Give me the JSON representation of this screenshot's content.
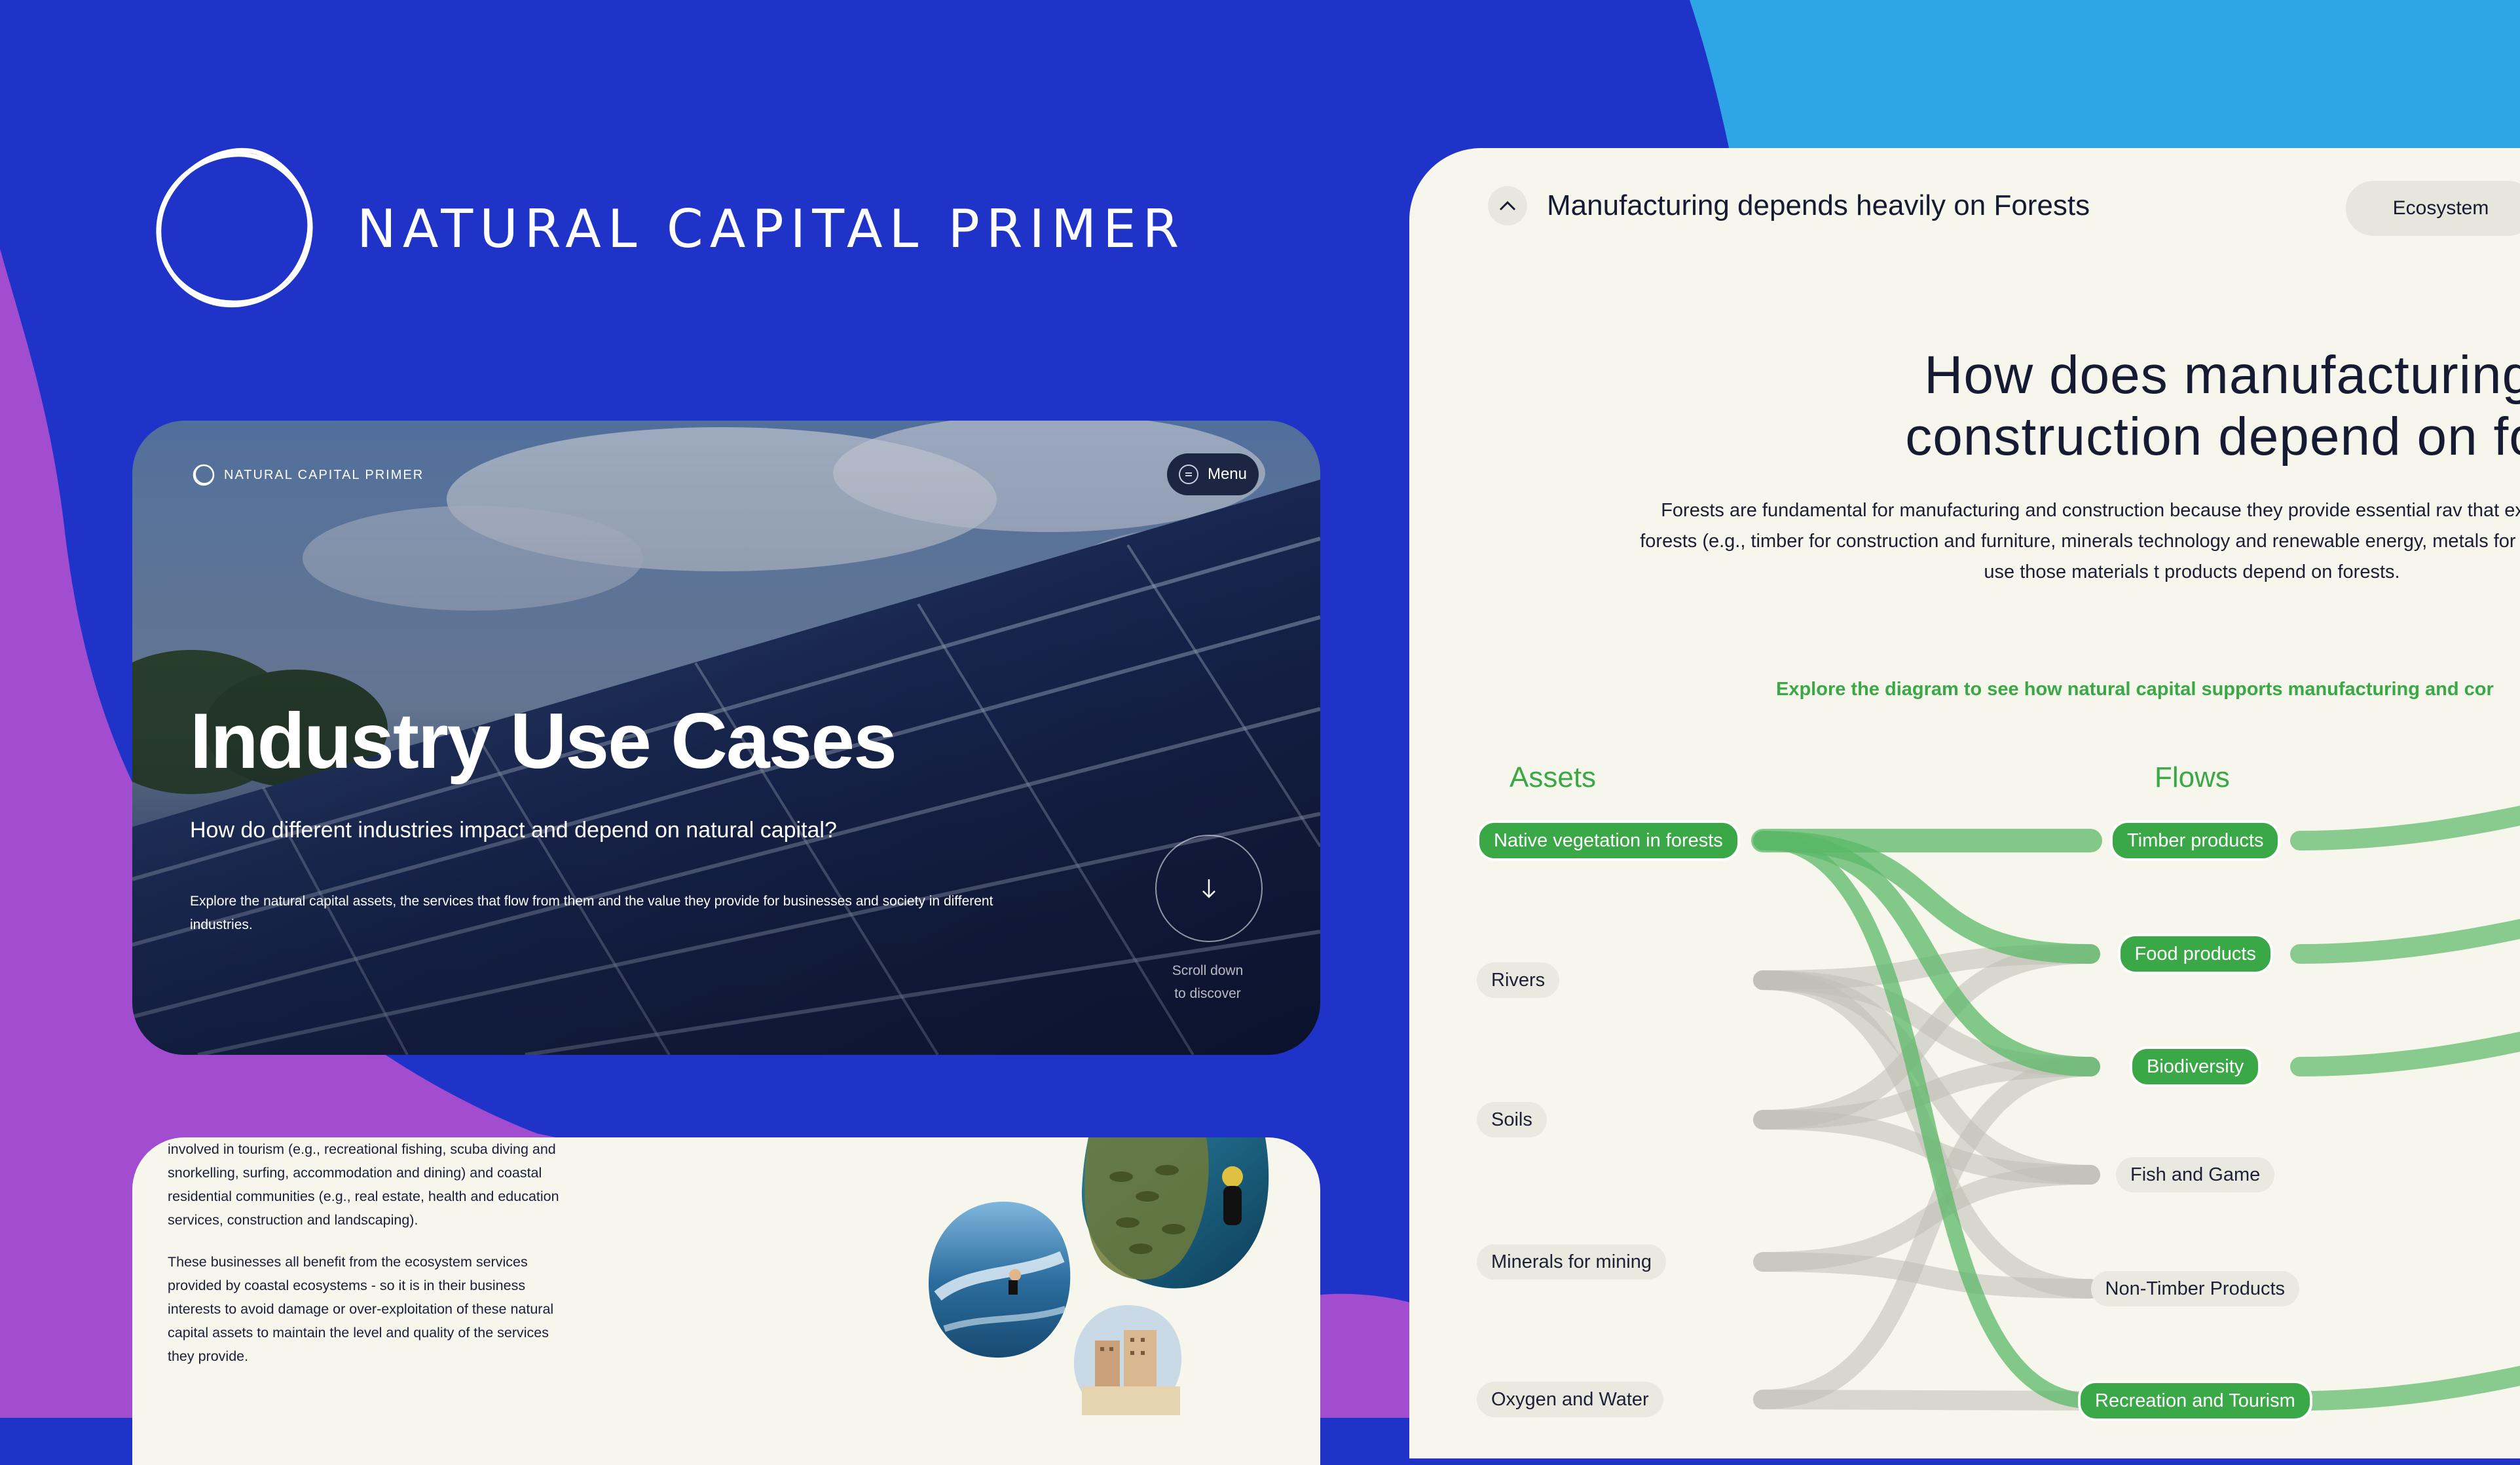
{
  "brand": {
    "title": "NATURAL CAPITAL PRIMER"
  },
  "colors": {
    "background": "#2033c9",
    "accent_purple": "#a24dd0",
    "accent_cyan": "#2ea6e6",
    "green": "#3aa847",
    "panel": "#f6f6ec"
  },
  "hero": {
    "logo_text": "NATURAL CAPITAL PRIMER",
    "menu_label": "Menu",
    "title": "Industry Use Cases",
    "subtitle": "How do different industries impact and depend on natural capital?",
    "body": "Explore the natural capital assets, the services that flow from them and the value they provide for businesses and society in different industries.",
    "scroll_line1": "Scroll down",
    "scroll_line2": "to discover",
    "scroll_icon": "arrow-down-icon"
  },
  "story": {
    "paragraph1": "involved in tourism (e.g., recreational fishing, scuba diving and snorkelling, surfing, accommodation and dining) and coastal residential communities (e.g., real estate, health and education services, construction and landscaping).",
    "paragraph2": "These businesses all benefit from the ecosystem services provided by coastal ecosystems - so it is in their business interests to avoid damage or over-exploitation of these natural capital assets to maintain the level and quality of the services they provide."
  },
  "panel": {
    "heading": "Manufacturing depends heavily on Forests",
    "tab": "Ecosystem",
    "question_line1": "How does manufacturing ar",
    "question_line2": "construction depend on fores",
    "desc": "Forests are fundamental for manufacturing and construction because they provide essential rav that extract raw materials from forests (e.g., timber for construction and furniture, minerals technology and renewable energy, metals for construction and wiring) or use those materials t products depend on forests.",
    "explore": "Explore the diagram to see how natural capital supports manufacturing and cor",
    "col_assets": "Assets",
    "col_flows": "Flows",
    "assets": [
      {
        "label": "Native vegetation in forests",
        "active": true
      },
      {
        "label": "Rivers",
        "active": false
      },
      {
        "label": "Soils",
        "active": false
      },
      {
        "label": "Minerals for mining",
        "active": false
      },
      {
        "label": "Oxygen and Water",
        "active": false
      }
    ],
    "flows": [
      {
        "label": "Timber products",
        "active": true
      },
      {
        "label": "Food products",
        "active": true
      },
      {
        "label": "Biodiversity",
        "active": true
      },
      {
        "label": "Fish and Game",
        "active": false
      },
      {
        "label": "Non-Timber Products",
        "active": false
      },
      {
        "label": "Recreation and Tourism",
        "active": true
      }
    ]
  }
}
